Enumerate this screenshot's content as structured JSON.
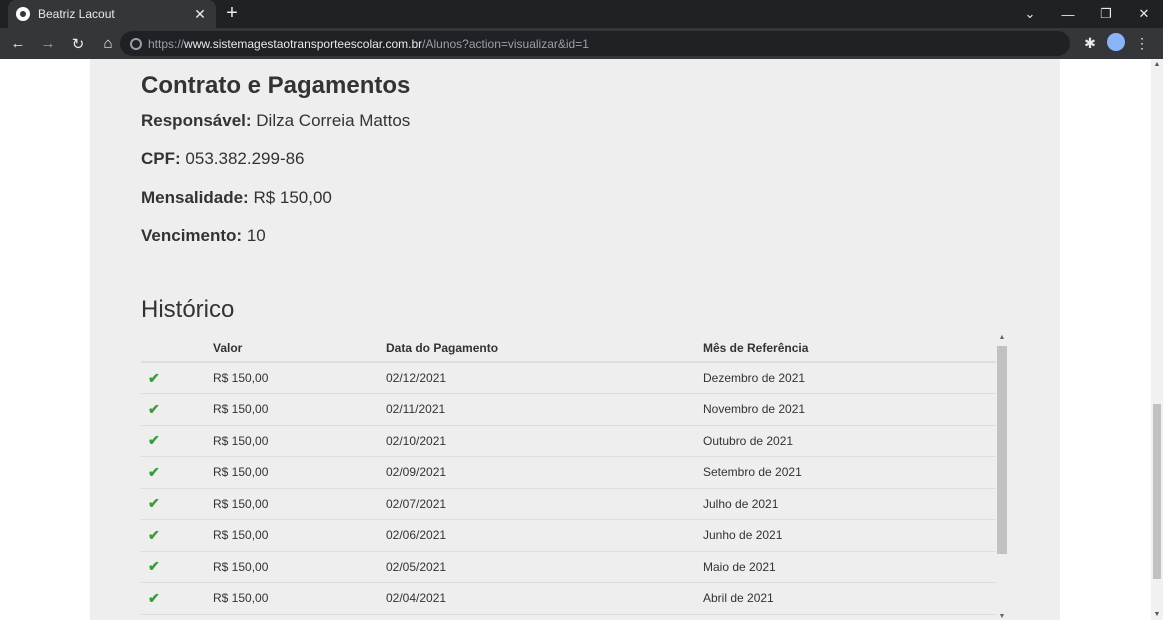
{
  "browser": {
    "tab_title": "Beatriz Lacout",
    "url_prefix": "https://",
    "url_domain": "www.sistemagestaotransporteescolar.com.br",
    "url_path": "/Alunos?action=visualizar&id=1"
  },
  "contract": {
    "heading": "Contrato e Pagamentos",
    "responsavel_label": "Responsável:",
    "responsavel_value": "Dilza Correia Mattos",
    "cpf_label": "CPF:",
    "cpf_value": "053.382.299-86",
    "mensalidade_label": "Mensalidade:",
    "mensalidade_value": "R$ 150,00",
    "vencimento_label": "Vencimento:",
    "vencimento_value": "10"
  },
  "history": {
    "heading": "Histórico",
    "columns": [
      "",
      "Valor",
      "Data do Pagamento",
      "Mês de Referência"
    ],
    "rows": [
      {
        "valor": "R$ 150,00",
        "data": "02/12/2021",
        "mes": "Dezembro de 2021"
      },
      {
        "valor": "R$ 150,00",
        "data": "02/11/2021",
        "mes": "Novembro de 2021"
      },
      {
        "valor": "R$ 150,00",
        "data": "02/10/2021",
        "mes": "Outubro de 2021"
      },
      {
        "valor": "R$ 150,00",
        "data": "02/09/2021",
        "mes": "Setembro de 2021"
      },
      {
        "valor": "R$ 150,00",
        "data": "02/07/2021",
        "mes": "Julho de 2021"
      },
      {
        "valor": "R$ 150,00",
        "data": "02/06/2021",
        "mes": "Junho de 2021"
      },
      {
        "valor": "R$ 150,00",
        "data": "02/05/2021",
        "mes": "Maio de 2021"
      },
      {
        "valor": "R$ 150,00",
        "data": "02/04/2021",
        "mes": "Abril de 2021"
      }
    ],
    "status_icon": "check-icon",
    "status_color": "#3c9b3c"
  }
}
